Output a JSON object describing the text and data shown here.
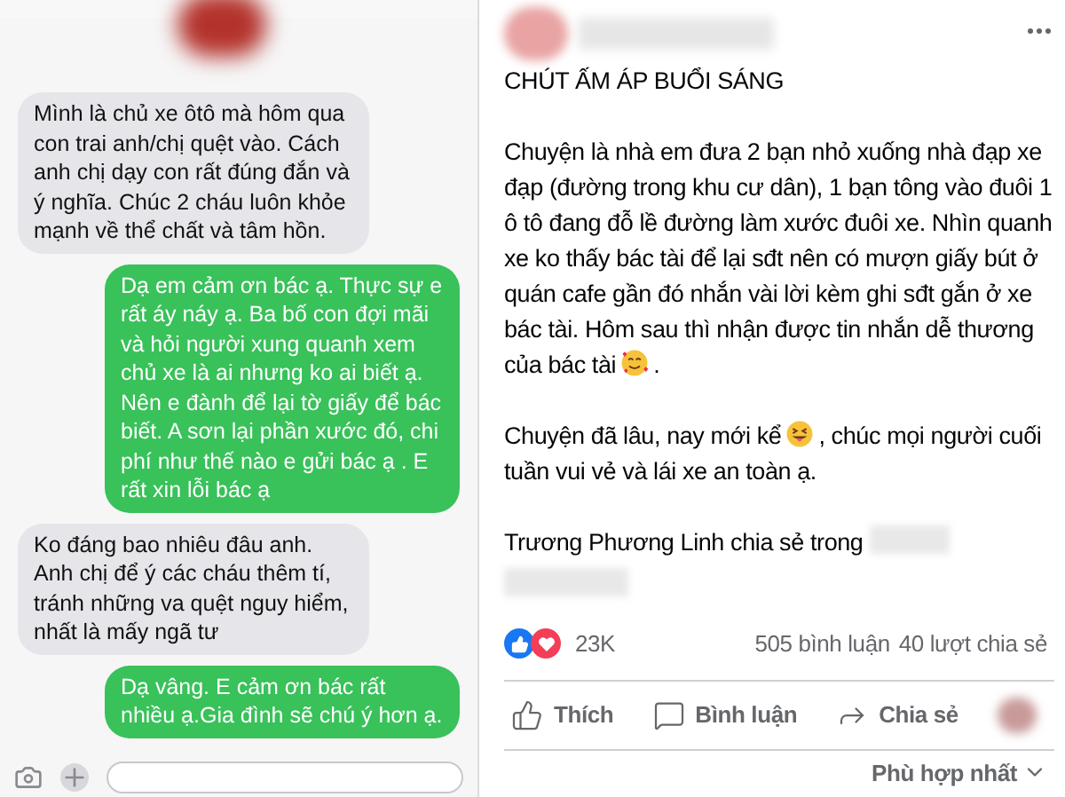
{
  "chat": {
    "messages": [
      {
        "kind": "incoming",
        "text": "Mình là chủ xe ôtô mà hôm qua con trai anh/chị quệt vào.  Cách anh chị dạy con rất đúng đắn và ý nghĩa. Chúc 2 cháu luôn khỏe mạnh về thể chất và tâm hồn."
      },
      {
        "kind": "outgoing",
        "text": "Dạ em cảm ơn bác ạ. Thực sự e rất áy náy ạ. Ba bố con đợi mãi và hỏi người xung quanh xem chủ xe là ai nhưng ko ai biết ạ. Nên e đành để lại tờ giấy để bác biết. A sơn lại phần xước đó, chi phí như thế nào e gửi bác ạ . E rất xin lỗi bác ạ"
      },
      {
        "kind": "incoming",
        "text": "Ko đáng bao nhiêu đâu anh. Anh chị để ý các cháu thêm tí, tránh những va quệt nguy hiểm, nhất là mấy ngã tư"
      },
      {
        "kind": "outgoing",
        "text": "Dạ vâng. E cảm ơn bác rất nhiều ạ.Gia đình sẽ chú ý hơn ạ."
      }
    ]
  },
  "post": {
    "title": "CHÚT ẤM ÁP BUỔI SÁNG",
    "paragraphs": [
      {
        "text": "Chuyện là nhà em đưa 2 bạn nhỏ xuống nhà đạp xe đạp (đường trong khu cư dân), 1 bạn tông vào đuôi 1 ô tô đang đỗ lề đường làm xước đuôi xe. Nhìn quanh xe ko thấy bác tài để lại sđt nên có mượn giấy bút ở quán cafe gần đó nhắn vài lời kèm ghi sđt gắn ở xe bác tài. Hôm sau thì nhận được tin nhắn dễ thương của bác tài",
        "emoji": {
          "kind": "hearts"
        },
        "after": "."
      },
      {
        "text": "Chuyện đã lâu, nay mới kể",
        "emoji": {
          "kind": "tongue"
        },
        "after": ", chúc mọi người cuối tuần vui vẻ và lái xe an toàn ạ."
      }
    ],
    "shared": "Trương Phương Linh chia sẻ trong",
    "reactions_count": "23K",
    "comments": "505 bình luận",
    "shares": "40 lượt chia sẻ",
    "actions": [
      {
        "kind": "like",
        "label": "Thích"
      },
      {
        "kind": "comment",
        "label": "Bình luận"
      },
      {
        "kind": "share",
        "label": "Chia sẻ"
      }
    ],
    "sort": "Phù hợp nhất"
  }
}
